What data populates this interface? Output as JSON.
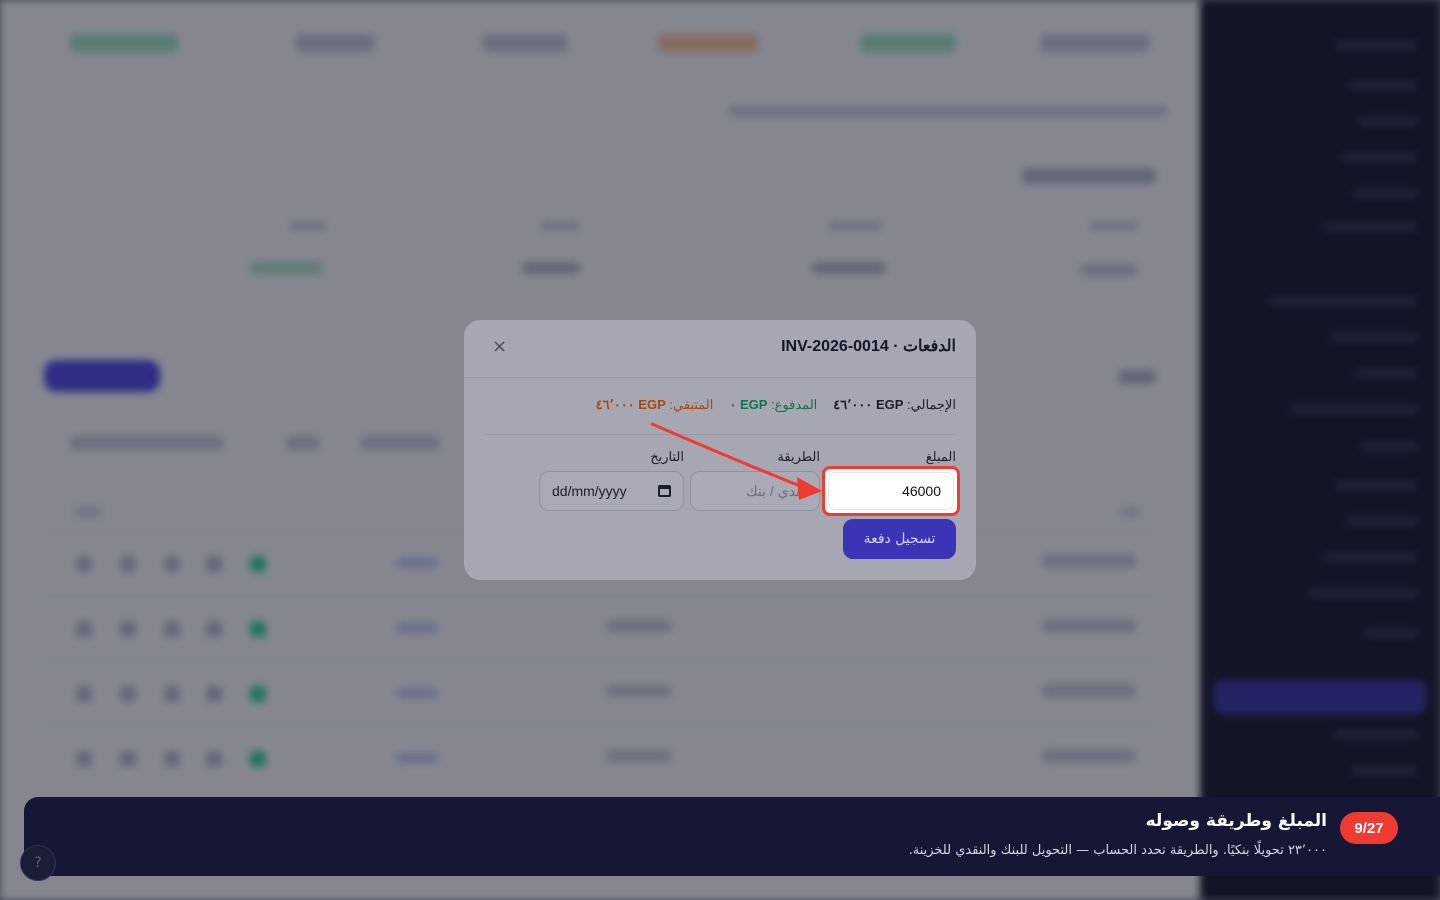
{
  "modal": {
    "title": "الدفعات · INV-2026-0014",
    "close_icon": "×",
    "summary": {
      "total_label": "الإجمالي:",
      "total_value": "EGP ٤٦٬٠٠٠",
      "paid_label": "المدفوع:",
      "paid_value": "EGP ٠",
      "remaining_label": "المتبقي:",
      "remaining_value": "EGP ٤٦٬٠٠٠"
    },
    "fields": {
      "amount_label": "المبلغ",
      "amount_value": "46000",
      "method_label": "الطريقة",
      "method_placeholder": "نقدي / بنك",
      "date_label": "التاريخ",
      "date_placeholder": "dd/mm/yyyy"
    },
    "save_label": "تسجيل دفعة"
  },
  "tour": {
    "step": "9/27",
    "title": "المبلغ وطريقة وصوله",
    "description": "٢٣٬٠٠٠ تحويلًا بنكيًا. والطريقة تحدد الحساب — التحويل للبنك والنقدي للخزينة."
  },
  "colors": {
    "accent": "#3b34b7",
    "highlight": "#ef3b32",
    "paid": "#17704c",
    "remaining": "#a54a14"
  }
}
